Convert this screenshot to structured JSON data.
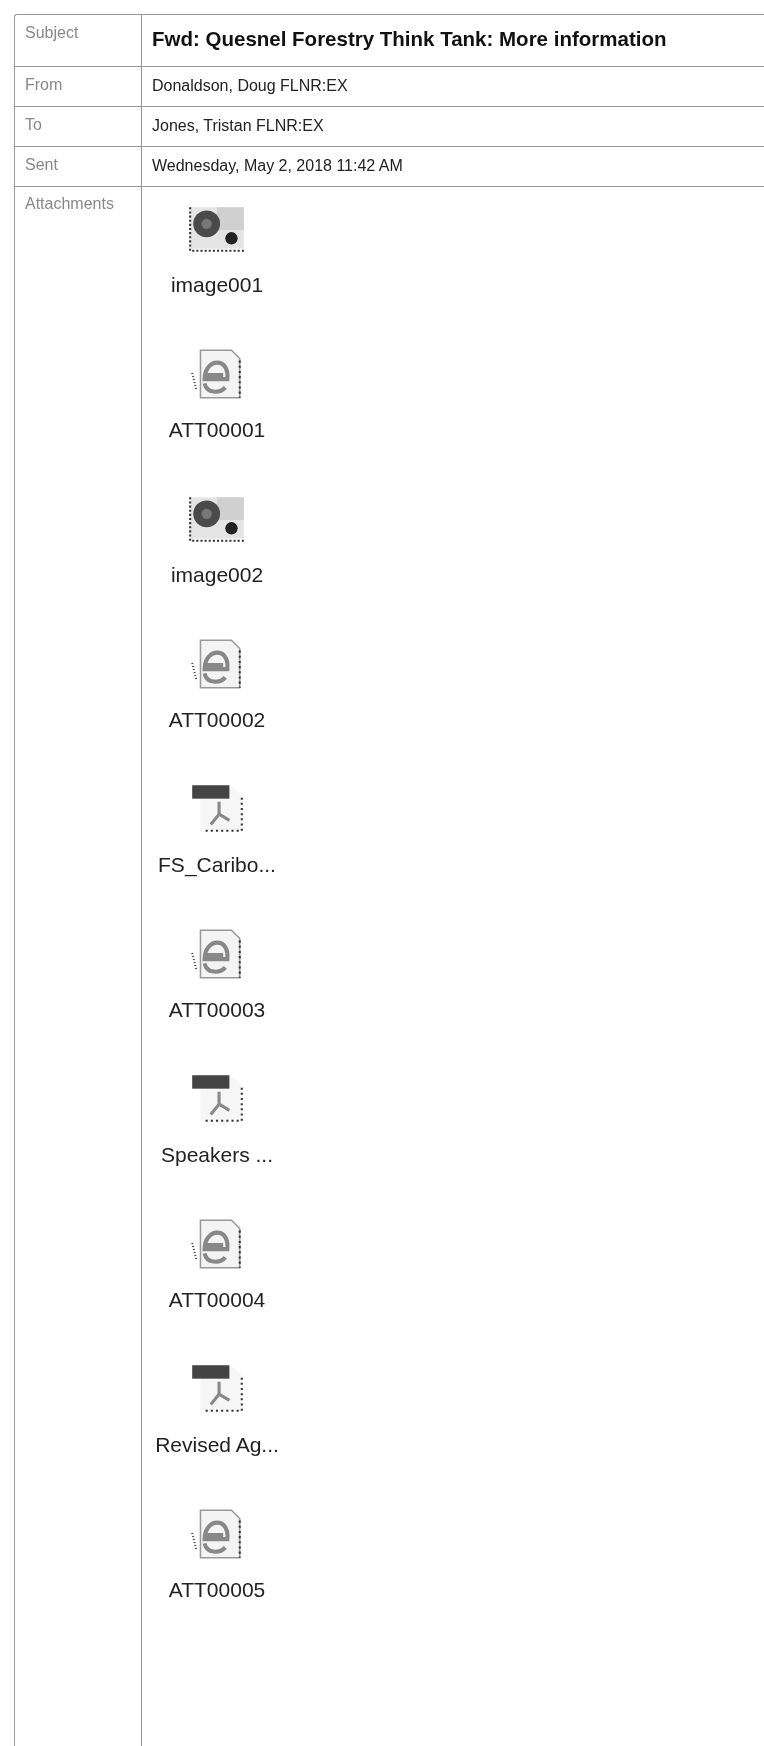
{
  "subject": {
    "label": "Subject",
    "value": "Fwd: Quesnel Forestry Think Tank: More information"
  },
  "fields": [
    {
      "label": "From",
      "value": "Donaldson, Doug FLNR:EX"
    },
    {
      "label": "To",
      "value": "Jones, Tristan FLNR:EX"
    },
    {
      "label": "Sent",
      "value": "Wednesday, May 2, 2018 11:42 AM"
    }
  ],
  "attachments": {
    "label": "Attachments",
    "items": [
      {
        "kind": "image",
        "name": "image001"
      },
      {
        "kind": "web",
        "name": "ATT00001"
      },
      {
        "kind": "image",
        "name": "image002"
      },
      {
        "kind": "web",
        "name": "ATT00002"
      },
      {
        "kind": "pdf",
        "name": "FS_Caribo..."
      },
      {
        "kind": "web",
        "name": "ATT00003"
      },
      {
        "kind": "pdf",
        "name": "Speakers ..."
      },
      {
        "kind": "web",
        "name": "ATT00004"
      },
      {
        "kind": "pdf",
        "name": "Revised Ag..."
      },
      {
        "kind": "web",
        "name": "ATT00005"
      }
    ]
  }
}
